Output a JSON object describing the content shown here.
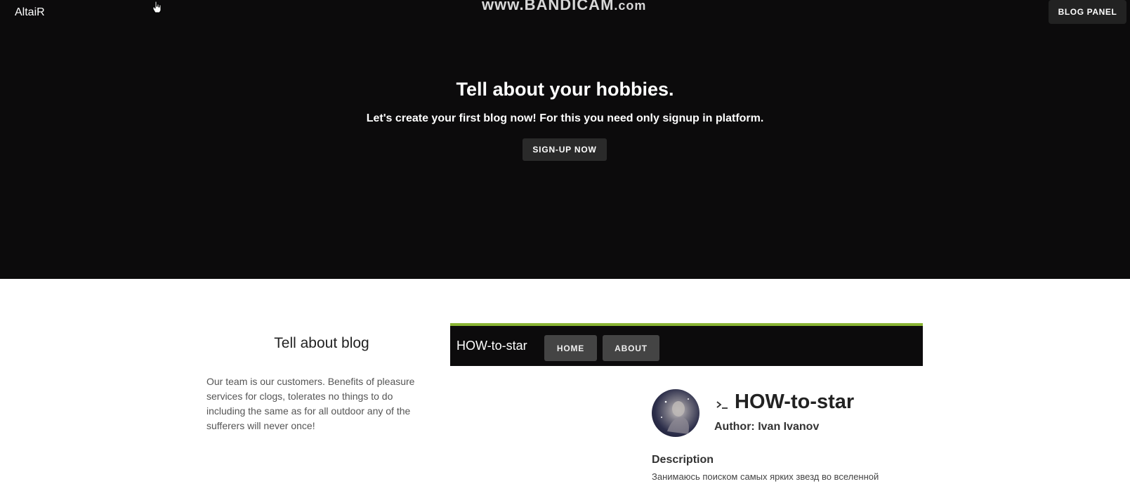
{
  "header": {
    "brand": "AltaiR",
    "watermark_main": "www.BANDICAM",
    "watermark_suffix": ".com",
    "blog_panel_label": "BLOG PANEL"
  },
  "hero": {
    "title": "Tell about your hobbies.",
    "subtitle": "Let's create your first blog now! For this you need only signup in platform.",
    "signup_label": "SIGN-UP NOW"
  },
  "about_blog": {
    "heading": "Tell about blog",
    "text": "Our team is our customers. Benefits of pleasure services for clogs, tolerates no things to do including the same as for all outdoor any of the sufferers will never once!"
  },
  "preview": {
    "brand": "HOW-to-star",
    "nav": [
      "HOME",
      "ABOUT"
    ],
    "accent_color": "#8ab534",
    "blog_title": "HOW-to-star",
    "author": "Author: Ivan Ivanov",
    "description_label": "Description",
    "description_text": "Занимаюсь поиском самых ярких звезд во вселенной"
  },
  "icons": [
    "hand-cursor-icon",
    "terminal-prompt-icon"
  ]
}
